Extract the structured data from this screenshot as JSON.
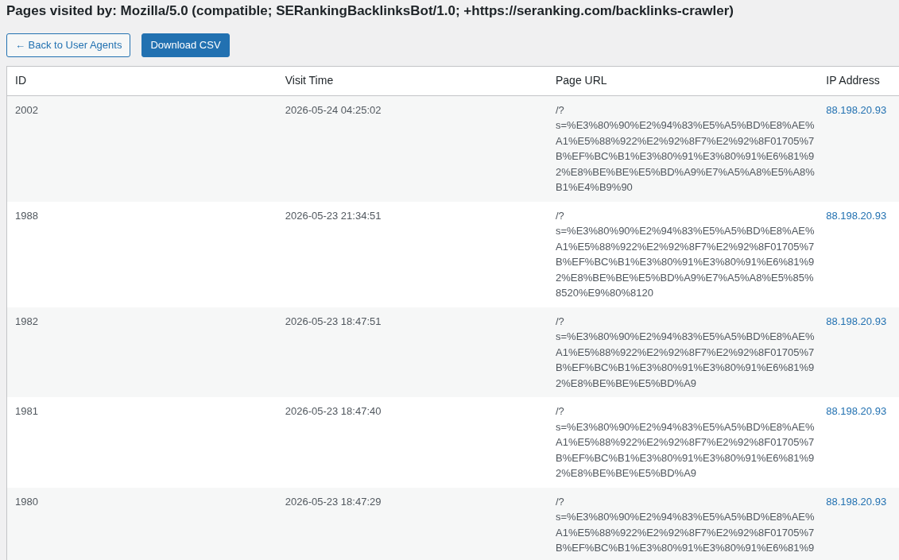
{
  "page": {
    "title": "Pages visited by: Mozilla/5.0 (compatible; SERankingBacklinksBot/1.0; +https://seranking.com/backlinks-crawler)"
  },
  "buttons": [
    {
      "label": "← Back to User Agents",
      "kind": "secondary"
    },
    {
      "label": "Download CSV",
      "kind": "primary"
    }
  ],
  "table": {
    "columns": [
      "ID",
      "Visit Time",
      "Page URL",
      "IP Address"
    ],
    "rows": [
      {
        "id": "2002",
        "visit_time": "2026-05-24 04:25:02",
        "page_url": "/?s=%E3%80%90%E2%94%83%E5%A5%BD%E8%AE%A1%E5%88%922%E2%92%8F7%E2%92%8F01705%7B%EF%BC%B1%E3%80%91%E3%80%91%E6%81%92%E8%BE%BE%E5%BD%A9%E7%A5%A8%E5%A8%B1%E4%B9%90",
        "ip_address": "88.198.20.93"
      },
      {
        "id": "1988",
        "visit_time": "2026-05-23 21:34:51",
        "page_url": "/?s=%E3%80%90%E2%94%83%E5%A5%BD%E8%AE%A1%E5%88%922%E2%92%8F7%E2%92%8F01705%7B%EF%BC%B1%E3%80%91%E3%80%91%E6%81%92%E8%BE%BE%E5%BD%A9%E7%A5%A8%E5%85%8520%E9%80%8120",
        "ip_address": "88.198.20.93"
      },
      {
        "id": "1982",
        "visit_time": "2026-05-23 18:47:51",
        "page_url": "/?s=%E3%80%90%E2%94%83%E5%A5%BD%E8%AE%A1%E5%88%922%E2%92%8F7%E2%92%8F01705%7B%EF%BC%B1%E3%80%91%E3%80%91%E6%81%92%E8%BE%BE%E5%BD%A9",
        "ip_address": "88.198.20.93"
      },
      {
        "id": "1981",
        "visit_time": "2026-05-23 18:47:40",
        "page_url": "/?s=%E3%80%90%E2%94%83%E5%A5%BD%E8%AE%A1%E5%88%922%E2%92%8F7%E2%92%8F01705%7B%EF%BC%B1%E3%80%91%E3%80%91%E6%81%92%E8%BE%BE%E5%BD%A9",
        "ip_address": "88.198.20.93"
      },
      {
        "id": "1980",
        "visit_time": "2026-05-23 18:47:29",
        "page_url": "/?s=%E3%80%90%E2%94%83%E5%A5%BD%E8%AE%A1%E5%88%922%E2%92%8F7%E2%92%8F01705%7B%EF%BC%B1%E3%80%91%E3%80%91%E6%81%9",
        "ip_address": "88.198.20.93"
      }
    ]
  }
}
